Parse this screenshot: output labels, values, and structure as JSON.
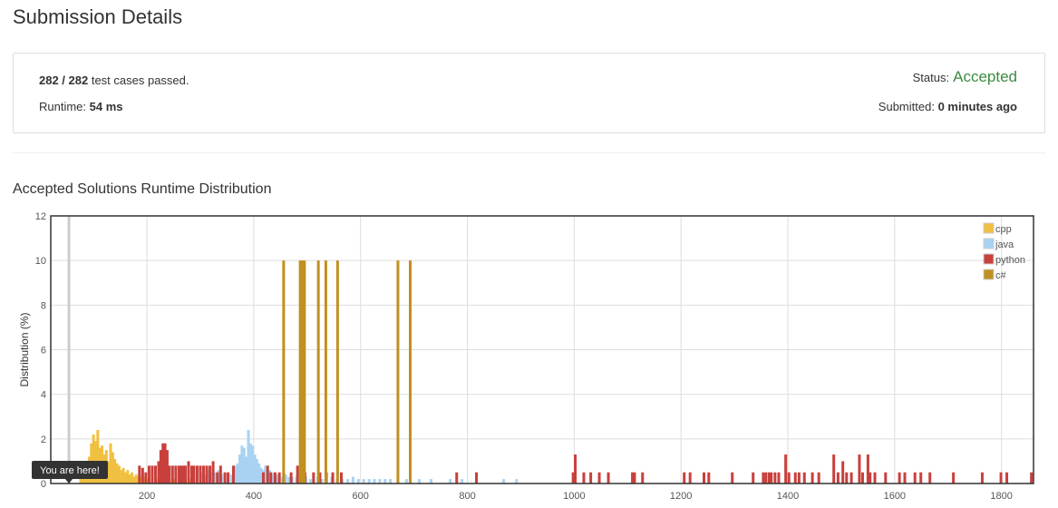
{
  "header": {
    "title": "Submission Details"
  },
  "details": {
    "passed": "282 / 282",
    "passed_suffix": " test cases passed.",
    "runtime_label": "Runtime:",
    "runtime_value": "54 ms",
    "status_label": "Status:",
    "status_value": "Accepted",
    "submitted_label": "Submitted:",
    "submitted_value": "0 minutes ago",
    "status_color": "#3d8a40"
  },
  "chart_section": {
    "title": "Accepted Solutions Runtime Distribution"
  },
  "chart_data": {
    "type": "bar",
    "title": "Accepted Solutions Runtime Distribution",
    "xlabel": "",
    "ylabel": "Distribution (%)",
    "xlim": [
      20,
      1860
    ],
    "ylim": [
      0,
      12
    ],
    "x_ticks": [
      200,
      400,
      600,
      800,
      1000,
      1200,
      1400,
      1600,
      1800
    ],
    "y_ticks": [
      0,
      2,
      4,
      6,
      8,
      10,
      12
    ],
    "grid": true,
    "legend_position": "top-right",
    "marker": {
      "label": "You are here!",
      "x": 54
    },
    "series": [
      {
        "name": "cpp",
        "color": "#f0c040",
        "points": [
          [
            76,
            0.3
          ],
          [
            80,
            0.5
          ],
          [
            84,
            0.9
          ],
          [
            88,
            0.7
          ],
          [
            92,
            1.2
          ],
          [
            96,
            1.8
          ],
          [
            100,
            2.2
          ],
          [
            104,
            1.9
          ],
          [
            108,
            2.4
          ],
          [
            112,
            1.6
          ],
          [
            116,
            1.7
          ],
          [
            120,
            1.3
          ],
          [
            124,
            1.5
          ],
          [
            128,
            1.0
          ],
          [
            132,
            1.8
          ],
          [
            136,
            1.4
          ],
          [
            140,
            1.1
          ],
          [
            144,
            0.9
          ],
          [
            148,
            0.8
          ],
          [
            152,
            0.6
          ],
          [
            156,
            0.7
          ],
          [
            160,
            0.5
          ],
          [
            164,
            0.6
          ],
          [
            168,
            0.4
          ],
          [
            172,
            0.5
          ],
          [
            176,
            0.3
          ],
          [
            180,
            0.4
          ],
          [
            184,
            0.3
          ],
          [
            188,
            0.3
          ],
          [
            192,
            0.4
          ],
          [
            196,
            0.3
          ],
          [
            200,
            0.2
          ],
          [
            204,
            0.3
          ],
          [
            210,
            0.3
          ],
          [
            218,
            0.2
          ],
          [
            226,
            0.2
          ],
          [
            234,
            0.2
          ],
          [
            242,
            0.2
          ],
          [
            250,
            0.2
          ],
          [
            262,
            0.2
          ],
          [
            272,
            0.2
          ],
          [
            282,
            0.2
          ]
        ]
      },
      {
        "name": "java",
        "color": "#a9d2f2",
        "points": [
          [
            304,
            0.5
          ],
          [
            310,
            0.4
          ],
          [
            316,
            0.6
          ],
          [
            322,
            0.5
          ],
          [
            328,
            0.5
          ],
          [
            334,
            0.6
          ],
          [
            340,
            0.4
          ],
          [
            346,
            0.4
          ],
          [
            352,
            0.5
          ],
          [
            358,
            0.4
          ],
          [
            362,
            0.6
          ],
          [
            366,
            0.8
          ],
          [
            370,
            0.9
          ],
          [
            374,
            1.3
          ],
          [
            378,
            1.7
          ],
          [
            382,
            1.6
          ],
          [
            386,
            1.2
          ],
          [
            390,
            2.4
          ],
          [
            394,
            1.8
          ],
          [
            398,
            1.7
          ],
          [
            402,
            1.3
          ],
          [
            406,
            1.1
          ],
          [
            410,
            0.9
          ],
          [
            414,
            0.7
          ],
          [
            418,
            0.6
          ],
          [
            422,
            0.8
          ],
          [
            426,
            0.5
          ],
          [
            430,
            0.6
          ],
          [
            434,
            0.4
          ],
          [
            438,
            0.5
          ],
          [
            444,
            0.4
          ],
          [
            448,
            0.3
          ],
          [
            454,
            0.3
          ],
          [
            460,
            0.4
          ],
          [
            466,
            0.3
          ],
          [
            472,
            0.3
          ],
          [
            480,
            0.3
          ],
          [
            490,
            0.3
          ],
          [
            498,
            0.3
          ],
          [
            506,
            0.2
          ],
          [
            512,
            0.2
          ],
          [
            520,
            0.3
          ],
          [
            528,
            0.2
          ],
          [
            536,
            0.2
          ],
          [
            546,
            0.3
          ],
          [
            556,
            0.2
          ],
          [
            566,
            0.2
          ],
          [
            576,
            0.2
          ],
          [
            586,
            0.3
          ],
          [
            596,
            0.2
          ],
          [
            606,
            0.2
          ],
          [
            616,
            0.2
          ],
          [
            626,
            0.2
          ],
          [
            636,
            0.2
          ],
          [
            646,
            0.2
          ],
          [
            656,
            0.2
          ],
          [
            670,
            0.2
          ],
          [
            686,
            0.2
          ],
          [
            710,
            0.2
          ],
          [
            732,
            0.2
          ],
          [
            768,
            0.2
          ],
          [
            790,
            0.2
          ],
          [
            868,
            0.2
          ],
          [
            892,
            0.2
          ]
        ]
      },
      {
        "name": "python",
        "color": "#c8403c",
        "points": [
          [
            186,
            0.8
          ],
          [
            192,
            0.7
          ],
          [
            198,
            0.5
          ],
          [
            204,
            0.8
          ],
          [
            210,
            0.8
          ],
          [
            216,
            0.8
          ],
          [
            222,
            1.0
          ],
          [
            226,
            1.5
          ],
          [
            230,
            1.8
          ],
          [
            234,
            1.8
          ],
          [
            238,
            1.5
          ],
          [
            242,
            0.8
          ],
          [
            248,
            0.8
          ],
          [
            254,
            0.8
          ],
          [
            260,
            0.8
          ],
          [
            264,
            0.8
          ],
          [
            268,
            0.8
          ],
          [
            272,
            0.8
          ],
          [
            278,
            1.0
          ],
          [
            284,
            0.8
          ],
          [
            288,
            0.8
          ],
          [
            294,
            0.8
          ],
          [
            300,
            0.8
          ],
          [
            306,
            0.8
          ],
          [
            312,
            0.8
          ],
          [
            318,
            0.8
          ],
          [
            324,
            1.0
          ],
          [
            332,
            0.5
          ],
          [
            338,
            0.8
          ],
          [
            346,
            0.5
          ],
          [
            352,
            0.5
          ],
          [
            362,
            0.8
          ],
          [
            418,
            0.5
          ],
          [
            426,
            0.8
          ],
          [
            432,
            0.5
          ],
          [
            440,
            0.5
          ],
          [
            448,
            0.5
          ],
          [
            456,
            0.5
          ],
          [
            470,
            0.5
          ],
          [
            482,
            0.8
          ],
          [
            496,
            0.5
          ],
          [
            512,
            0.5
          ],
          [
            524,
            0.5
          ],
          [
            536,
            0.5
          ],
          [
            548,
            0.5
          ],
          [
            564,
            0.5
          ],
          [
            780,
            0.5
          ],
          [
            817,
            0.5
          ],
          [
            998,
            0.5
          ],
          [
            1002,
            1.3
          ],
          [
            1018,
            0.5
          ],
          [
            1031,
            0.5
          ],
          [
            1047,
            0.5
          ],
          [
            1064,
            0.5
          ],
          [
            1109,
            0.5
          ],
          [
            1113,
            0.5
          ],
          [
            1128,
            0.5
          ],
          [
            1206,
            0.5
          ],
          [
            1217,
            0.5
          ],
          [
            1243,
            0.5
          ],
          [
            1252,
            0.5
          ],
          [
            1296,
            0.5
          ],
          [
            1335,
            0.5
          ],
          [
            1354,
            0.5
          ],
          [
            1359,
            0.5
          ],
          [
            1365,
            0.5
          ],
          [
            1369,
            0.5
          ],
          [
            1376,
            0.5
          ],
          [
            1383,
            0.5
          ],
          [
            1396,
            1.3
          ],
          [
            1402,
            0.5
          ],
          [
            1414,
            0.5
          ],
          [
            1421,
            0.5
          ],
          [
            1431,
            0.5
          ],
          [
            1446,
            0.5
          ],
          [
            1458,
            0.5
          ],
          [
            1486,
            1.3
          ],
          [
            1494,
            0.5
          ],
          [
            1503,
            1.0
          ],
          [
            1510,
            0.5
          ],
          [
            1519,
            0.5
          ],
          [
            1534,
            1.3
          ],
          [
            1540,
            0.5
          ],
          [
            1550,
            1.3
          ],
          [
            1554,
            0.5
          ],
          [
            1563,
            0.5
          ],
          [
            1583,
            0.5
          ],
          [
            1609,
            0.5
          ],
          [
            1619,
            0.5
          ],
          [
            1638,
            0.5
          ],
          [
            1649,
            0.5
          ],
          [
            1666,
            0.5
          ],
          [
            1710,
            0.5
          ],
          [
            1764,
            0.5
          ],
          [
            1799,
            0.5
          ],
          [
            1810,
            0.5
          ],
          [
            1856,
            0.5
          ]
        ]
      },
      {
        "name": "c#",
        "color": "#c09020",
        "points": [
          [
            456,
            10
          ],
          [
            487,
            10
          ],
          [
            491,
            10
          ],
          [
            495,
            10
          ],
          [
            521,
            10
          ],
          [
            535,
            10
          ],
          [
            557,
            10
          ],
          [
            670,
            10
          ],
          [
            693,
            10
          ]
        ]
      }
    ]
  }
}
